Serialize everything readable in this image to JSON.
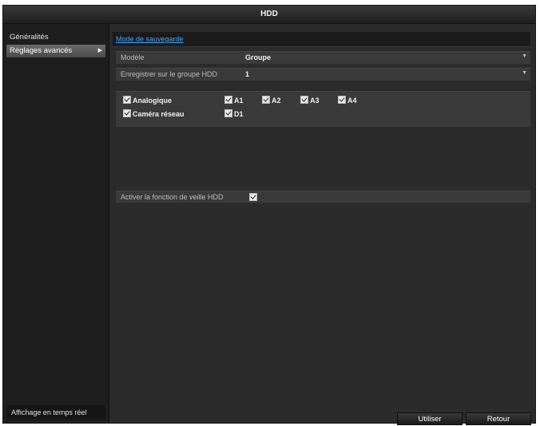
{
  "window": {
    "title": "HDD"
  },
  "sidebar": {
    "items": [
      {
        "label": "Généralités",
        "active": false
      },
      {
        "label": "Réglages avancés",
        "active": true
      }
    ],
    "live_view_label": "Affichage en temps réel"
  },
  "tabs": {
    "active_label": "Mode de sauvegarde"
  },
  "form": {
    "mode": {
      "label": "Modèle",
      "value": "Groupe"
    },
    "hdd_group": {
      "label": "Enregistrer sur le groupe HDD",
      "value": "1"
    },
    "channels": {
      "analog": {
        "label": "Analogique",
        "checked": true,
        "items": [
          {
            "label": "A1",
            "checked": true
          },
          {
            "label": "A2",
            "checked": true
          },
          {
            "label": "A3",
            "checked": true
          },
          {
            "label": "A4",
            "checked": true
          }
        ]
      },
      "ip_camera": {
        "label": "Caméra réseau",
        "checked": true,
        "items": [
          {
            "label": "D1",
            "checked": true
          }
        ]
      }
    },
    "standby": {
      "label": "Activer la fonction de veille HDD",
      "checked": true
    }
  },
  "buttons": {
    "apply_label": "Utiliser",
    "back_label": "Retour"
  },
  "colors": {
    "background": "#2b2b2b",
    "sidebar": "#1e1e1e",
    "row": "#3a3a3a",
    "link": "#3fa6ff"
  }
}
